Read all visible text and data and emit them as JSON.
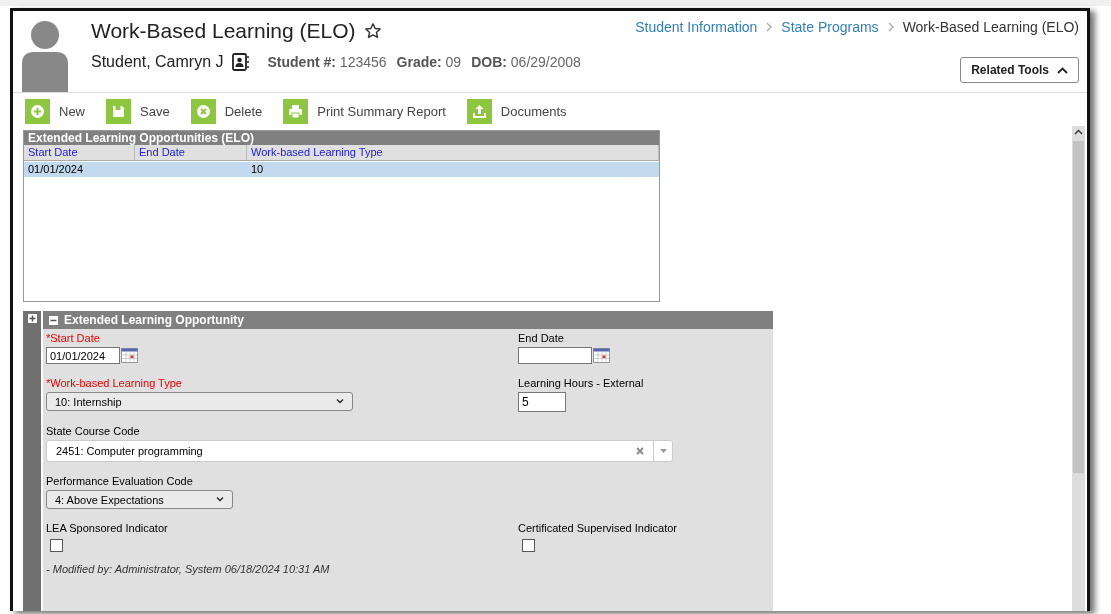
{
  "page": {
    "title": "Work-Based Learning (ELO)"
  },
  "breadcrumbs": [
    {
      "label": "Student Information",
      "kind": "link"
    },
    {
      "label": "State Programs",
      "kind": "link"
    },
    {
      "label": "Work-Based Learning (ELO)",
      "kind": "current"
    }
  ],
  "student": {
    "name": "Student, Camryn J",
    "fields": [
      {
        "label": "Student #:",
        "value": "123456"
      },
      {
        "label": "Grade:",
        "value": "09"
      },
      {
        "label": "DOB:",
        "value": "06/29/2008"
      }
    ]
  },
  "related_tools": {
    "label": "Related Tools"
  },
  "toolbar": [
    {
      "label": "New",
      "kind": "new"
    },
    {
      "label": "Save",
      "kind": "save"
    },
    {
      "label": "Delete",
      "kind": "delete"
    },
    {
      "label": "Print Summary Report",
      "kind": "print"
    },
    {
      "label": "Documents",
      "kind": "documents"
    }
  ],
  "list": {
    "title": "Extended Learning Opportunities (ELO)",
    "columns": [
      "Start Date",
      "End Date",
      "Work-based Learning Type"
    ],
    "rows": [
      {
        "cells": [
          "01/01/2024",
          "",
          "10"
        ],
        "selected": true
      }
    ]
  },
  "form": {
    "title": "Extended Learning Opportunity",
    "rows": [
      [
        {
          "kind": "date",
          "label": "*Start Date",
          "required": true,
          "value": "01/01/2024"
        },
        {
          "kind": "date",
          "label": "End Date",
          "required": false
        }
      ],
      [
        {
          "kind": "select",
          "label": "*Work-based Learning Type",
          "required": true,
          "value": "10: Internship"
        },
        {
          "kind": "text",
          "label": "Learning Hours - External",
          "required": false,
          "value": "5"
        }
      ],
      [
        {
          "kind": "combo",
          "label": "State Course Code",
          "required": false,
          "value": "2451: Computer programming"
        }
      ],
      [
        {
          "kind": "select",
          "label": "Performance Evaluation Code",
          "required": false,
          "value": "4: Above Expectations"
        }
      ],
      [
        {
          "kind": "checkbox",
          "label": "LEA Sponsored Indicator",
          "required": false,
          "checked": false
        },
        {
          "kind": "checkbox",
          "label": "Certificated Supervised Indicator",
          "required": false,
          "checked": false
        }
      ]
    ],
    "modified": "- Modified by: Administrator, System 06/18/2024 10:31 AM"
  }
}
